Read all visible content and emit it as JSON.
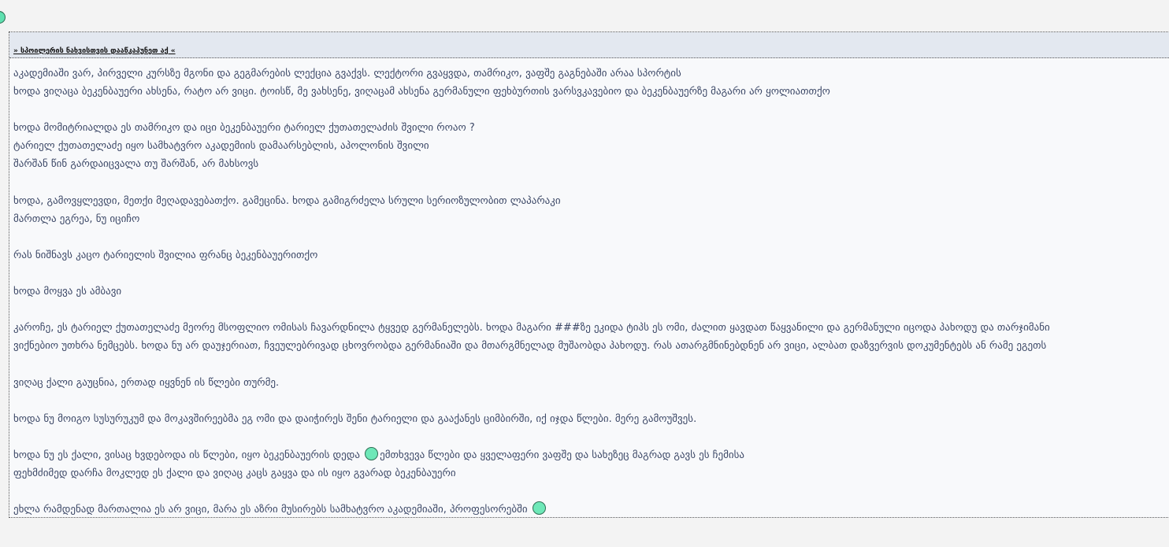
{
  "spoiler": {
    "toggle_label": "» სპოილერის ნახვისთვის დააწკაპუნეთ აქ «",
    "lines": [
      {
        "text": "აკადემიაში ვარ, პირველი კურსზე მგონი და გეგმარების ლექცია გვაქვს. ლექტორი გვაყვდა, თამრიკო, ვაფშე გაგნებაში არაა სპორტის"
      },
      {
        "text": "ხოდა ვიღაცა ბეკენბაუერი ახსენა, რატო არ ვიცი. ტოისწ, მე ვახსენე, ვიღაცამ ახსენა გერმანული ფეხბურთის ვარსვკავებიო და ბეკენბაუერზე მაგარი არ ყოლიათთქო"
      },
      {
        "text": ""
      },
      {
        "text": "ხოდა მომიტრიალდა ეს თამრიკო და იცი ბეკენბაუერი ტარიელ ქუთათელაძის შვილი როაო ?"
      },
      {
        "text": "ტარიელ ქუთათელაძე იყო სამხატვრო აკადემიის დამაარსებლის, აპოლონის შვილი"
      },
      {
        "text": "შარშან წინ გარდაიცვალა თუ შარშან, არ მახსოვს"
      },
      {
        "text": ""
      },
      {
        "text": "ხოდა, გამოვყლევდი, მეთქი მეღადავებათქო. გამეცინა. ხოდა გამიგრძელა სრული სერიოზულობით ლაპარაკი"
      },
      {
        "text": "მართლა ეგრეა, ნუ იციჩო"
      },
      {
        "text": ""
      },
      {
        "text": "რას ნიშნავს კაცო ტარიელის შვილია ფრანც ბეკენბაუერითქო"
      },
      {
        "text": ""
      },
      {
        "text": "ხოდა მოყვა ეს ამბავი"
      },
      {
        "text": ""
      },
      {
        "text": "კაროჩე, ეს ტარიელ ქუთათელაძე მეორე მსოფლიო ომისას ჩავარდნილა ტყვედ გერმანელებს. ხოდა მაგარი ###ზე ეკიდა ტიპს ეს ომი, ძალით ყავდათ წაყვანილი და გერმანული იცოდა პახოდუ და თარჯიმანი"
      },
      {
        "text": "ვიქნებიო უთხრა ნემცებს. ხოდა ნუ არ დაუჯერიათ, ჩვეულებრივად ცხოვრობდა გერმანიაში და მთარგმნელად მუშაობდა პახოდუ. რას ათარგმნინებდნენ არ ვიცი, ალბათ დაზვერვის დოკუმენტებს ან რამე ეგეთს"
      },
      {
        "text": ""
      },
      {
        "text": "ვიღაც ქალი გაუცნია, ერთად იყვნენ ის წლები თურმე."
      },
      {
        "text": ""
      },
      {
        "text": "ხოდა ნუ მოიგო სუსურუკუმ და მოკავშირეებმა ეგ ომი და დაიჭირეს შენი ტარიელი და გააქანეს ციმბირში, იქ იჯდა წლები. მერე გამოუშვეს."
      },
      {
        "text": ""
      },
      {
        "text": "ხოდა ნუ ეს ქალი, ვისაც ხვდებოდა ის წლები, იყო ბეკენბაუერის დედა",
        "smiley": "smiley-icon",
        "after": "ემთხვევა წლები და ყველაფერი ვაფშე და სახეზეც მაგრად გავს ეს ჩემისა"
      },
      {
        "text": "ფეხმძიმედ დარჩა მოკლედ ეს ქალი და ვიღაც კაცს გაყვა და ის იყო გვარად ბეკენბაუერი"
      },
      {
        "text": ""
      },
      {
        "text": "ეხლა რამდენად მართალია ეს არ ვიცი, მარა ეს აზრი მუსირებს სამხატვრო აკადემიაში, პროფესორებში",
        "smiley": "smiley-icon",
        "after": ""
      }
    ]
  },
  "colors": {
    "text": "#3b4766",
    "header_bg": "#e3e8f0",
    "body_bg": "#f8f9fb",
    "smiley": "#6ee8b8"
  }
}
